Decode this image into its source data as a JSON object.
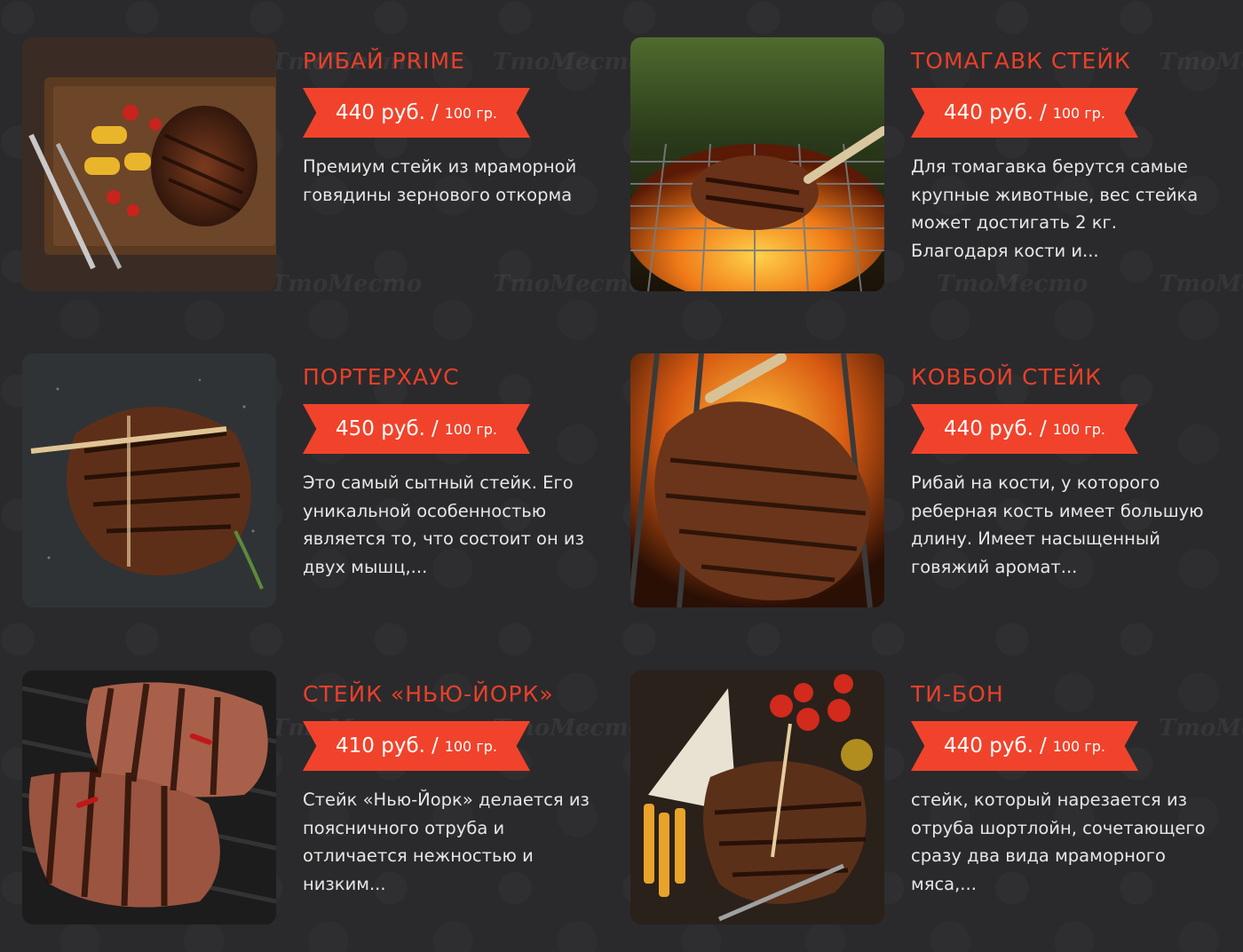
{
  "watermark_text": "ТтоМесто",
  "colors": {
    "accent": "#e8402a",
    "ribbon": "#f1432b",
    "background": "#2a2a2c",
    "text": "#e6e6e6"
  },
  "items": [
    {
      "title": "РИБАЙ PRIME",
      "price": "440 руб.",
      "unit": "100 гр.",
      "description": "Премиум стейк из мраморной говядины зернового откорма"
    },
    {
      "title": "ТОМАГАВК СТЕЙК",
      "price": "440 руб.",
      "unit": "100 гр.",
      "description": "Для томагавка берутся самые крупные животные, вес стейка может достигать 2 кг. Благодаря кости и..."
    },
    {
      "title": "ПОРТЕРХАУС",
      "price": "450 руб.",
      "unit": "100 гр.",
      "description": "Это самый сытный стейк. Его уникальной особенностью является то, что состоит он из двух мышц,..."
    },
    {
      "title": "КОВБОЙ СТЕЙК",
      "price": "440 руб.",
      "unit": "100 гр.",
      "description": "Рибай на кости, у которого реберная кость имеет большую длину. Имеет насыщенный говяжий аромат..."
    },
    {
      "title": "СТЕЙК «НЬЮ-ЙОРК»",
      "price": "410 руб.",
      "unit": "100 гр.",
      "description": "Стейк «Нью-Йорк» делается из поясничного отруба и отличается нежностью и низким..."
    },
    {
      "title": "ТИ-БОН",
      "price": "440 руб.",
      "unit": "100 гр.",
      "description": "стейк, который нарезается из отруба шортлойн, сочетающего сразу два вида мраморного мяса,..."
    }
  ]
}
